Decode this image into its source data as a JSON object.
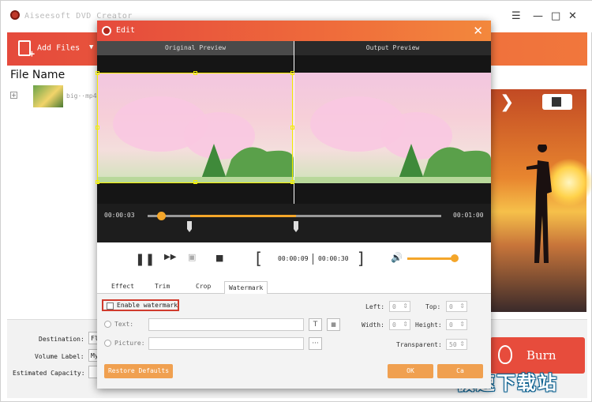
{
  "app": {
    "title": "Aiseesoft DVD Creator"
  },
  "window_controls": {
    "menu_icon": "menu-icon",
    "minimize": "—",
    "maximize": "□",
    "close": "✕"
  },
  "toolbar": {
    "add_files": "Add Files",
    "dropdown": "▼"
  },
  "file_list": {
    "header": "File Name",
    "expand": "+",
    "file_name": "big··mp4"
  },
  "preview": {
    "next": "❯"
  },
  "bottom": {
    "destination_label": "Destination:",
    "destination_value": "Fle",
    "volume_label": "Volume Label:",
    "volume_value": "My",
    "capacity_label": "Estimated Capacity:",
    "burn_label": "Burn"
  },
  "watermark_site": "极速下载站",
  "edit": {
    "title": "Edit",
    "close": "✕",
    "original_preview": "Original Preview",
    "output_preview": "Output Preview",
    "time_current": "00:00:03",
    "time_total": "00:01:00",
    "clip_start": "00:00:09",
    "clip_end": "00:00:30",
    "tabs": [
      "Effect",
      "Trim",
      "Crop",
      "Watermark"
    ],
    "enable_watermark": "Enable watermark",
    "text_label": "Text:",
    "picture_label": "Picture:",
    "text_btn": "T",
    "picture_btn": "···",
    "left_label": "Left:",
    "left_value": "0",
    "top_label": "Top:",
    "top_value": "0",
    "width_label": "Width:",
    "width_value": "0",
    "height_label": "Height:",
    "height_value": "0",
    "transparent_label": "Transparent:",
    "transparent_value": "50",
    "restore_defaults": "Restore Defaults",
    "ok": "OK",
    "cancel": "Ca"
  }
}
